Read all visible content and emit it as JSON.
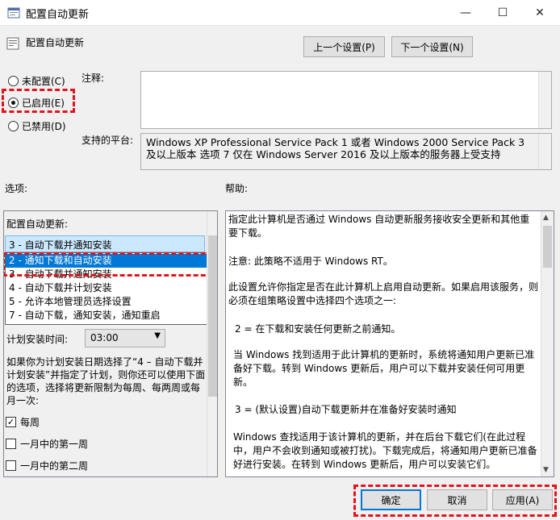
{
  "window": {
    "title": "配置自动更新",
    "minimize_glyph": "—",
    "maximize_glyph": "☐",
    "close_glyph": "✕"
  },
  "header": {
    "policy_title": "配置自动更新",
    "prev_label": "上一个设置(P)",
    "next_label": "下一个设置(N)"
  },
  "state": {
    "not_configured": "未配置(C)",
    "enabled": "已启用(E)",
    "disabled": "已禁用(D)",
    "selected": "enabled"
  },
  "comment": {
    "label": "注释:",
    "value": ""
  },
  "platform": {
    "label": "支持的平台:",
    "text": "Windows XP Professional Service Pack 1 或者 Windows 2000 Service Pack 3 及以上版本 选项 7 仅在 Windows Server 2016 及以上版本的服务器上受支持"
  },
  "options": {
    "label": "选项:",
    "configure_label": "配置自动更新:",
    "dropdown_current": "3 - 自动下载并通知安装",
    "dropdown_items": [
      "2 - 通知下载和自动安装",
      "3 - 自动下载并通知安装",
      "4 - 自动下载并计划安装",
      "5 - 允许本地管理员选择设置",
      "7 - 自动下载，通知安装，通知重启"
    ],
    "dropdown_selected_index": 0,
    "schedule_label": "计划安装时间:",
    "schedule_value": "03:00",
    "description": "如果你为计划安装日期选择了“4 – 自动下载并计划安装”并指定了计划，则你还可以使用下面的选项，选择将更新限制为每周、每两周或每月一次:",
    "weekly_label": "每周",
    "weekly_checked": true,
    "first_week_label": "一月中的第一周",
    "second_week_label": "一月中的第二周"
  },
  "help": {
    "label": "帮助:",
    "paragraphs": [
      "指定此计算机是否通过 Windows 自动更新服务接收安全更新和其他重要下载。",
      "注意: 此策略不适用于 Windows RT。",
      "此设置允许你指定是否在此计算机上启用自动更新。如果启用该服务，则必须在组策略设置中选择四个选项之一:",
      "2 = 在下载和安装任何更新之前通知。",
      "当 Windows 找到适用于此计算机的更新时，系统将通知用户更新已准备好下载。转到 Windows 更新后，用户可以下载并安装任何可用更新。",
      "3 = (默认设置)自动下载更新并在准备好安装时通知",
      "Windows 查找适用于该计算机的更新，并在后台下载它们(在此过程中，用户不会收到通知或被打扰)。下载完成后，将通知用户更新已准备好进行安装。在转到 Windows 更新后，用户可以安装它们。"
    ]
  },
  "footer": {
    "ok_label": "确定",
    "cancel_label": "取消",
    "apply_label": "应用(A)"
  },
  "colors": {
    "highlight_red": "#e0141e",
    "selection_blue": "#0078d7"
  }
}
